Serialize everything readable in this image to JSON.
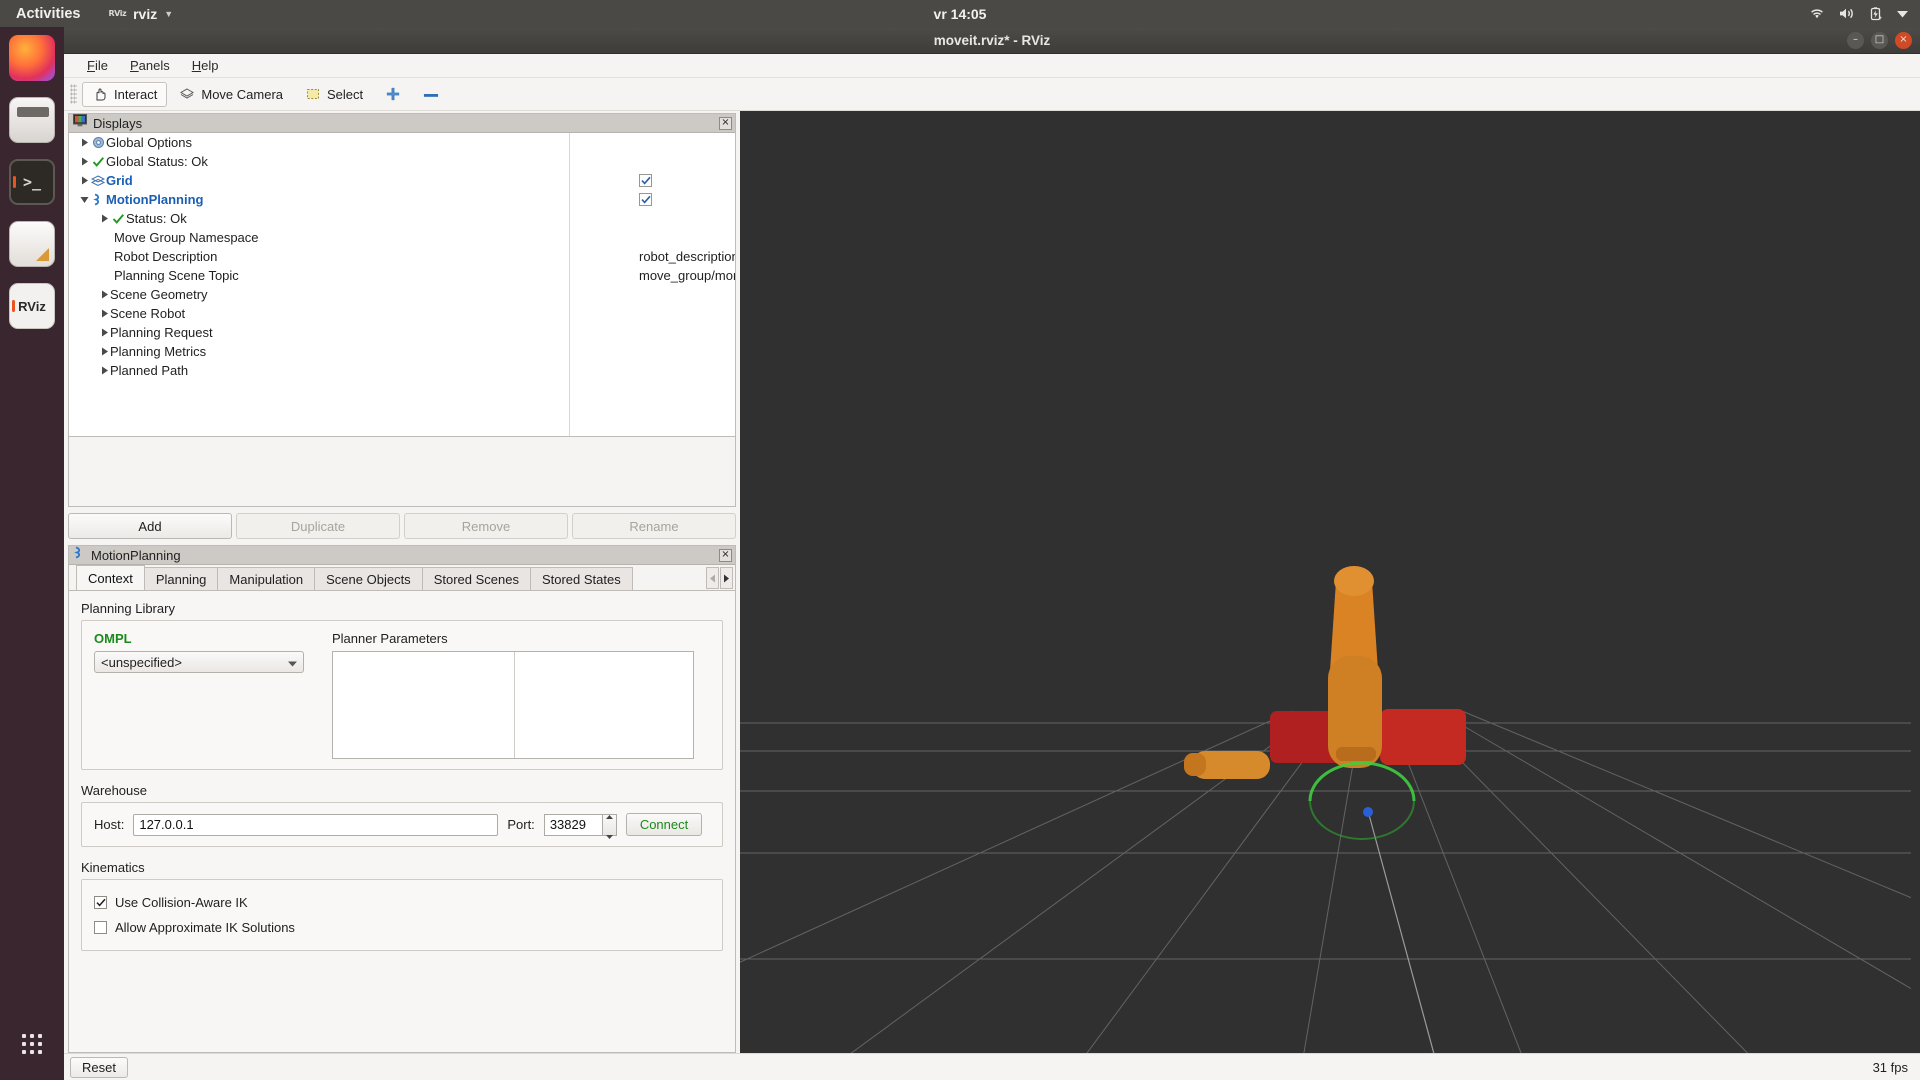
{
  "topbar": {
    "activities": "Activities",
    "app_icon_text": "RViz",
    "app_name": "rviz",
    "clock": "vr 14:05",
    "tray": [
      "wifi-icon",
      "volume-icon",
      "battery-charging-icon",
      "system-menu-caret-icon"
    ]
  },
  "dock": {
    "items": [
      {
        "name": "firefox",
        "label": "Firefox",
        "running": false
      },
      {
        "name": "files",
        "label": "Files",
        "running": false
      },
      {
        "name": "terminal",
        "label": "Terminal",
        "running": true
      },
      {
        "name": "text-editor",
        "label": "Text Editor",
        "running": false
      },
      {
        "name": "rviz",
        "label": "RViz",
        "text": "RViz",
        "running": true
      }
    ],
    "show_apps": "Show Applications"
  },
  "window": {
    "title": "moveit.rviz* - RViz",
    "minimize": "–",
    "maximize": "□",
    "close": "×"
  },
  "menubar": [
    {
      "pre": "",
      "mnemonic": "F",
      "post": "ile"
    },
    {
      "pre": "",
      "mnemonic": "P",
      "post": "anels"
    },
    {
      "pre": "",
      "mnemonic": "H",
      "post": "elp"
    }
  ],
  "toolbar": [
    {
      "label": "Interact",
      "icon": "hand-icon",
      "active": true
    },
    {
      "label": "Move Camera",
      "icon": "camera-move-icon",
      "active": false
    },
    {
      "label": "Select",
      "icon": "select-rect-icon",
      "active": false
    },
    {
      "label": "",
      "icon": "focus-camera-icon",
      "active": false
    },
    {
      "label": "",
      "icon": "measure-icon",
      "active": false
    }
  ],
  "displays": {
    "panel_title": "Displays",
    "panel_icon": "displays-monitor-icon",
    "close_label": "×",
    "rows": [
      {
        "label": "Global Options",
        "icon": "gear-icon",
        "indent": 1,
        "arrow": "right",
        "bold": false,
        "value": null,
        "checkbox": null
      },
      {
        "label": "Global Status: Ok",
        "icon": "check-icon",
        "indent": 1,
        "arrow": "right",
        "bold": false,
        "value": null,
        "checkbox": null
      },
      {
        "label": "Grid",
        "icon": "layers-icon",
        "indent": 1,
        "arrow": "right",
        "bold": true,
        "value": null,
        "checkbox": true
      },
      {
        "label": "MotionPlanning",
        "icon": "motion-icon",
        "indent": 1,
        "arrow": "down",
        "bold": true,
        "value": null,
        "checkbox": true
      },
      {
        "label": "Status: Ok",
        "icon": "check-icon",
        "indent": 2,
        "arrow": "right",
        "bold": false,
        "value": null,
        "checkbox": null
      },
      {
        "label": "Move Group Namespace",
        "icon": null,
        "indent": 3,
        "arrow": null,
        "bold": false,
        "value": "",
        "checkbox": null
      },
      {
        "label": "Robot Description",
        "icon": null,
        "indent": 3,
        "arrow": null,
        "bold": false,
        "value": "robot_description",
        "checkbox": null
      },
      {
        "label": "Planning Scene Topic",
        "icon": null,
        "indent": 3,
        "arrow": null,
        "bold": false,
        "value": "move_group/monitor...",
        "checkbox": null
      },
      {
        "label": "Scene Geometry",
        "icon": null,
        "indent": 2,
        "arrow": "right",
        "bold": false,
        "value": null,
        "checkbox": null
      },
      {
        "label": "Scene Robot",
        "icon": null,
        "indent": 2,
        "arrow": "right",
        "bold": false,
        "value": null,
        "checkbox": null
      },
      {
        "label": "Planning Request",
        "icon": null,
        "indent": 2,
        "arrow": "right",
        "bold": false,
        "value": null,
        "checkbox": null
      },
      {
        "label": "Planning Metrics",
        "icon": null,
        "indent": 2,
        "arrow": "right",
        "bold": false,
        "value": null,
        "checkbox": null
      },
      {
        "label": "Planned Path",
        "icon": null,
        "indent": 2,
        "arrow": "right",
        "bold": false,
        "value": null,
        "checkbox": null
      }
    ],
    "buttons": [
      {
        "label": "Add",
        "enabled": true
      },
      {
        "label": "Duplicate",
        "enabled": false
      },
      {
        "label": "Remove",
        "enabled": false
      },
      {
        "label": "Rename",
        "enabled": false
      }
    ]
  },
  "motion_planning": {
    "panel_title": "MotionPlanning",
    "panel_icon": "motion-icon",
    "close_label": "×",
    "tabs": [
      {
        "label": "Context",
        "selected": true
      },
      {
        "label": "Planning",
        "selected": false
      },
      {
        "label": "Manipulation",
        "selected": false
      },
      {
        "label": "Scene Objects",
        "selected": false
      },
      {
        "label": "Stored Scenes",
        "selected": false
      },
      {
        "label": "Stored States",
        "selected": false
      }
    ],
    "tab_scroll_left": "◀",
    "tab_scroll_right": "▶",
    "planning_library": {
      "section_label": "Planning Library",
      "library_name": "OMPL",
      "planner_value": "<unspecified>",
      "params_label": "Planner Parameters",
      "params_rows": []
    },
    "warehouse": {
      "section_label": "Warehouse",
      "host_label": "Host:",
      "host_value": "127.0.0.1",
      "port_label": "Port:",
      "port_value": "33829",
      "connect_label": "Connect"
    },
    "kinematics": {
      "section_label": "Kinematics",
      "options": [
        {
          "label": "Use Collision-Aware IK",
          "checked": true
        },
        {
          "label": "Allow Approximate IK Solutions",
          "checked": false
        }
      ]
    }
  },
  "bottom": {
    "reset_label": "Reset",
    "fps": "31 fps"
  },
  "colors": {
    "accent_blue": "#1a5fb4",
    "accent_green": "#1a8a1a",
    "ubuntu_orange": "#e95420",
    "viewport_bg": "#303030",
    "panel_bg": "#f5f4f2",
    "titlebar": "#4a4945"
  }
}
